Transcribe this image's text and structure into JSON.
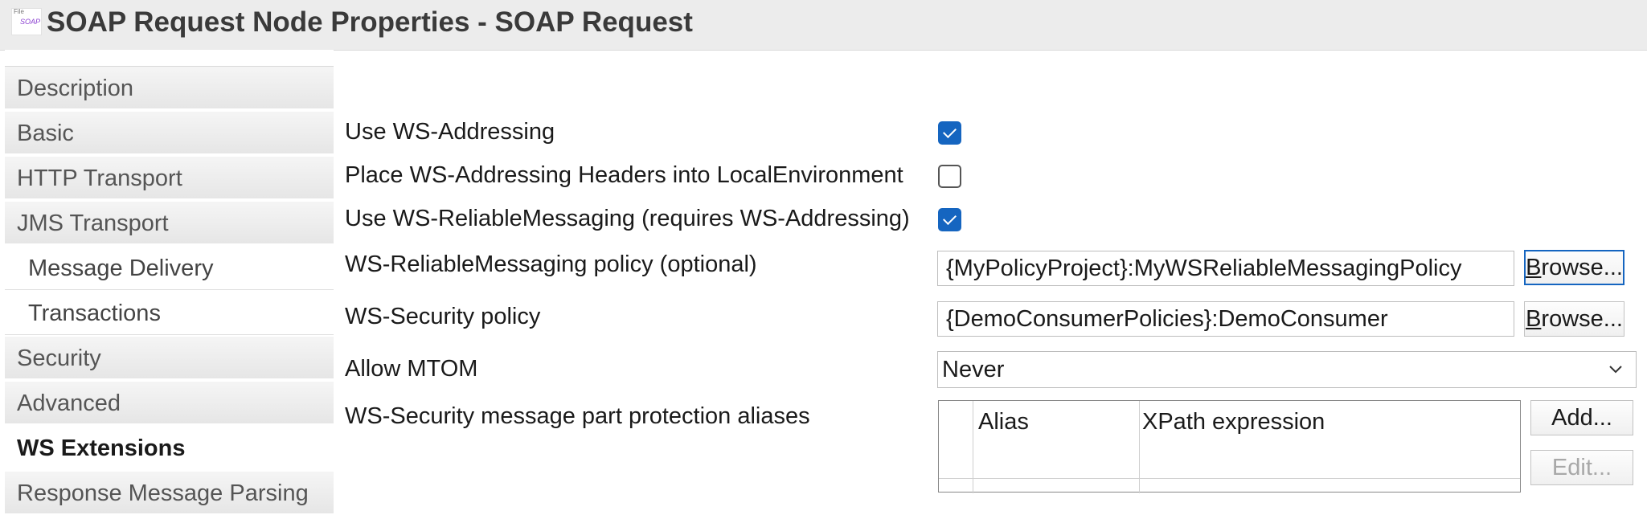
{
  "window": {
    "title": "SOAP Request Node Properties - SOAP Request",
    "icon_small_text": "File",
    "icon_text": "SOAP"
  },
  "sidebar": {
    "items": [
      {
        "label": "Description"
      },
      {
        "label": "Basic"
      },
      {
        "label": "HTTP Transport"
      },
      {
        "label": "JMS Transport"
      },
      {
        "label": "Message Delivery"
      },
      {
        "label": "Transactions"
      },
      {
        "label": "Security"
      },
      {
        "label": "Advanced"
      },
      {
        "label": "WS Extensions"
      },
      {
        "label": "Response Message Parsing"
      }
    ]
  },
  "form": {
    "use_ws_addressing": {
      "label": "Use WS-Addressing",
      "checked": true
    },
    "place_headers": {
      "label": "Place WS-Addressing Headers into LocalEnvironment",
      "checked": false
    },
    "use_ws_rm": {
      "label": "Use WS-ReliableMessaging (requires WS-Addressing)",
      "checked": true
    },
    "ws_rm_policy": {
      "label": "WS-ReliableMessaging policy (optional)",
      "value": "{MyPolicyProject}:MyWSReliableMessagingPolicy",
      "button_label": "rowse...",
      "button_mnemonic": "B"
    },
    "ws_security_policy": {
      "label": "WS-Security policy",
      "value": "{DemoConsumerPolicies}:DemoConsumer",
      "button_label": "rowse...",
      "button_mnemonic": "B"
    },
    "allow_mtom": {
      "label": "Allow MTOM",
      "value": "Never"
    },
    "aliases": {
      "label": "WS-Security message part protection aliases",
      "columns": [
        "Alias",
        "XPath expression"
      ],
      "add_label": "Add...",
      "edit_label": "Edit..."
    }
  },
  "colors": {
    "accent": "#1565c0",
    "titlebar": "#ececec",
    "sidebar_tab": "#e6e6e6"
  }
}
